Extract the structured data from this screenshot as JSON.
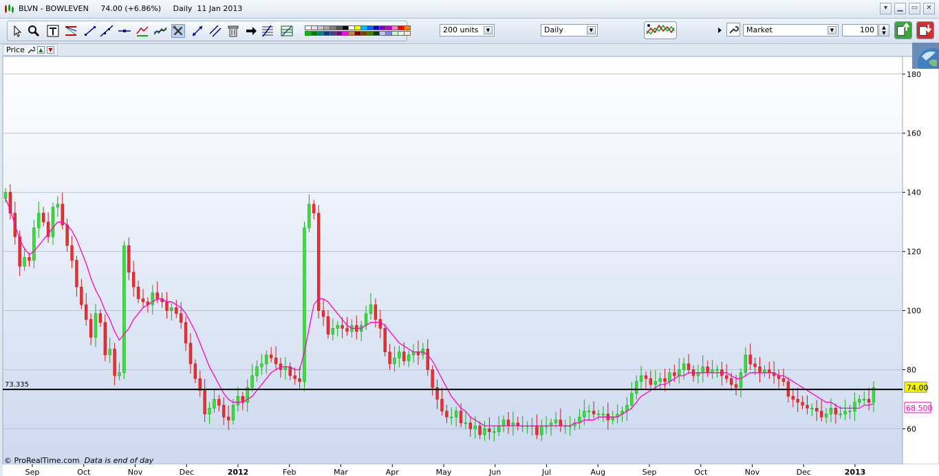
{
  "window": {
    "title": "BLVN - BOWLEVEN     74.00 (+6.86%)     Daily  11 Jan 2013",
    "buttons": [
      "▾",
      "▁",
      "▭",
      "✕"
    ]
  },
  "toolbar": {
    "units_select": "200 units",
    "period_select": "Daily",
    "order_type_select": "Market",
    "quantity": "100",
    "icons": [
      "pointer-icon",
      "zoom-icon",
      "text-icon",
      "fan-icon",
      "segment-icon",
      "line-icon",
      "horizontal-line-icon",
      "channel-icon",
      "trend-icon",
      "tools-icon",
      "arrows-icon",
      "parallel-icon",
      "trash-icon",
      "arrow-right-icon",
      "fibonacci-icon",
      "retracement-icon"
    ],
    "colors": [
      "#ffffff",
      "#e0e0e0",
      "#c8c8c8",
      "#a8a8a8",
      "#808080",
      "#505050",
      "#000000",
      "#ffffff",
      "#ffff00",
      "#00c0ff",
      "#0060ff",
      "#0000c0",
      "#8000c0",
      "#c000c0",
      "#ff80c0",
      "#ff0000",
      "#ff8000",
      "#00c000",
      "#008000",
      "#008080",
      "#004080",
      "#404080",
      "#800080",
      "#ff00ff",
      "#c08040",
      "#800000",
      "#804000",
      "#408000",
      "#004000",
      "#c0c0ff",
      "#8080ff",
      "#c0ffc0",
      "#e0ffe0",
      "#ffe0e0"
    ]
  },
  "panel": {
    "label": "Price"
  },
  "footer": {
    "source": "© ProRealTime.com",
    "note": "Data is end of day"
  },
  "chart_data": {
    "type": "candlestick",
    "ylim": [
      48,
      186
    ],
    "yticks": [
      60,
      80,
      100,
      120,
      140,
      160,
      180
    ],
    "xlabels": [
      "Sep",
      "Oct",
      "Nov",
      "Dec",
      "2012",
      "Feb",
      "Mar",
      "Apr",
      "May",
      "Jun",
      "Jul",
      "Aug",
      "Sep",
      "Oct",
      "Nov",
      "Dec",
      "2013"
    ],
    "bold_xlabels": [
      "2012",
      "2013"
    ],
    "grid": true,
    "horizontal_line": {
      "value": 73.335,
      "label": "73.335"
    },
    "last_price": {
      "value": 74.0,
      "label": "74.00",
      "color": "#f7f700"
    },
    "ma_value": {
      "value": 68.5,
      "label": "68.500",
      "color": "#ff00cc"
    },
    "series": [
      {
        "name": "close",
        "values": [
          140,
          133,
          125,
          115,
          118,
          117,
          128,
          133,
          130,
          125,
          135,
          136,
          129,
          122,
          117,
          108,
          102,
          97,
          91,
          99,
          96,
          85,
          87,
          78,
          79,
          122,
          113,
          108,
          104,
          103,
          102,
          106,
          104,
          103,
          100,
          101,
          99,
          96,
          89,
          82,
          77,
          73,
          65,
          67,
          70,
          68,
          64,
          63,
          68,
          71,
          69,
          74,
          78,
          81,
          82,
          85,
          84,
          82,
          80,
          81,
          78,
          77,
          76,
          128,
          136,
          133,
          100,
          98,
          92,
          94,
          95,
          94,
          93,
          95,
          93,
          95,
          99,
          102,
          97,
          94,
          86,
          82,
          84,
          86,
          83,
          85,
          86,
          85,
          87,
          80,
          74,
          70,
          66,
          64,
          64,
          66,
          62,
          62,
          60,
          61,
          58,
          60,
          59,
          59,
          61,
          63,
          61,
          62,
          61,
          61,
          61,
          61,
          58,
          61,
          61,
          62,
          63,
          61,
          61,
          61,
          62,
          64,
          66,
          66,
          65,
          65,
          65,
          63,
          64,
          65,
          66,
          68,
          72,
          76,
          78,
          77,
          75,
          76,
          77,
          76,
          79,
          78,
          80,
          82,
          80,
          78,
          79,
          81,
          79,
          80,
          80,
          78,
          77,
          75,
          74,
          79,
          85,
          82,
          81,
          79,
          80,
          79,
          78,
          77,
          76,
          71,
          70,
          69,
          68,
          67,
          67,
          66,
          64,
          65,
          67,
          65,
          65,
          66,
          66,
          69,
          70,
          70,
          69,
          74
        ]
      },
      {
        "name": "ma",
        "values": [
          138,
          134,
          129,
          124,
          121,
          119,
          120,
          122,
          124,
          126,
          128,
          130,
          130,
          129,
          127,
          124,
          120,
          116,
          111,
          107,
          104,
          100,
          97,
          93,
          90,
          92,
          94,
          97,
          99,
          101,
          102,
          103,
          104,
          104,
          103,
          103,
          102,
          101,
          99,
          96,
          93,
          89,
          85,
          81,
          78,
          75,
          72,
          70,
          69,
          69,
          69,
          70,
          71,
          73,
          75,
          77,
          79,
          80,
          81,
          81,
          81,
          80,
          80,
          86,
          94,
          102,
          104,
          104,
          103,
          101,
          99,
          97,
          95,
          94,
          94,
          94,
          95,
          96,
          96,
          96,
          95,
          93,
          91,
          89,
          88,
          87,
          86,
          86,
          86,
          85,
          83,
          80,
          77,
          74,
          71,
          69,
          67,
          66,
          64,
          63,
          62,
          61,
          61,
          61,
          61,
          61,
          61,
          61,
          61,
          61,
          61,
          61,
          61,
          61,
          61,
          61,
          61,
          61,
          61,
          61,
          62,
          62,
          63,
          63,
          63,
          64,
          64,
          64,
          64,
          64,
          65,
          66,
          67,
          69,
          71,
          72,
          73,
          74,
          75,
          75,
          76,
          77,
          78,
          78,
          79,
          79,
          79,
          79,
          79,
          79,
          79,
          79,
          79,
          78,
          77,
          77,
          78,
          79,
          79,
          79,
          79,
          79,
          79,
          78,
          78,
          77,
          76,
          75,
          74,
          73,
          72,
          71,
          70,
          69,
          69,
          68,
          67,
          67,
          67,
          67,
          67,
          68,
          68,
          68.5
        ]
      }
    ]
  }
}
